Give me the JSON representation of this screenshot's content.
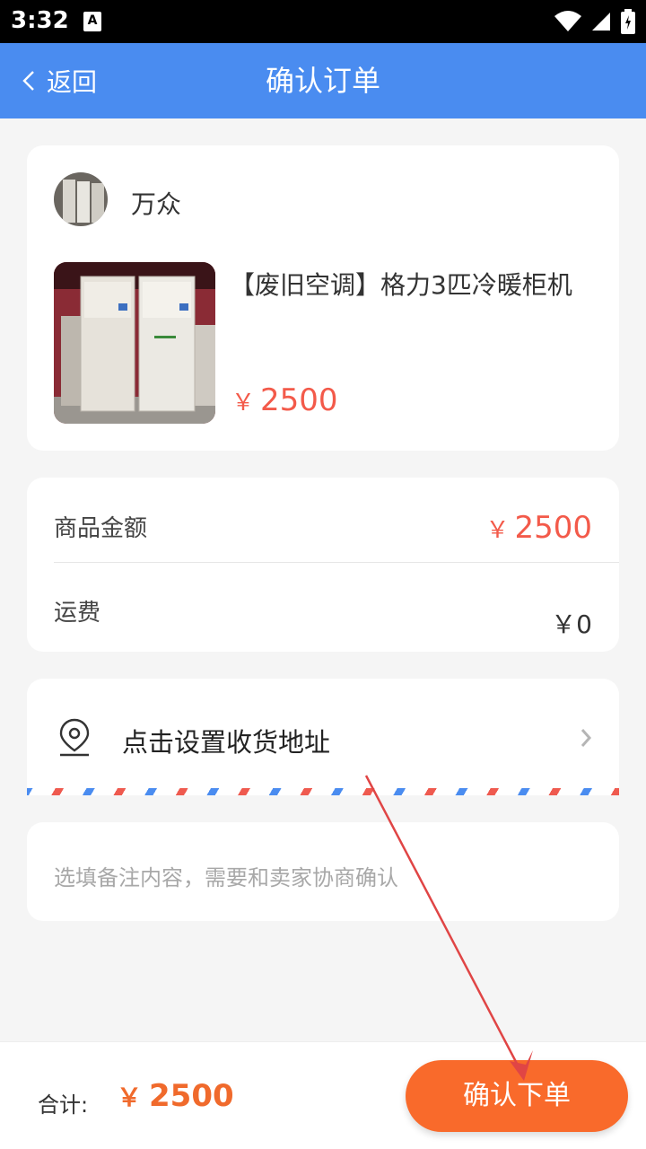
{
  "status_bar": {
    "time": "3:32",
    "notification_icon": "A"
  },
  "nav": {
    "back_label": "返回",
    "title": "确认订单"
  },
  "shop": {
    "seller_name": "万众",
    "product_title": "【废旧空调】格力3匹冷暖柜机",
    "currency": "￥",
    "price": "2500"
  },
  "fees": {
    "goods_amount_label": "商品金额",
    "goods_amount_currency": "￥",
    "goods_amount_value": "2500",
    "shipping_label": "运费",
    "shipping_value": "￥0"
  },
  "address": {
    "prompt": "点击设置收货地址"
  },
  "note": {
    "placeholder": "选填备注内容，需要和卖家协商确认"
  },
  "footer": {
    "total_label": "合计:",
    "total_currency": "￥",
    "total_value": "2500",
    "submit_label": "确认下单"
  },
  "colors": {
    "nav_blue": "#4a8cf0",
    "price_red": "#f35a4a",
    "total_orange": "#f06a2c",
    "button_orange": "#f96a2b"
  }
}
